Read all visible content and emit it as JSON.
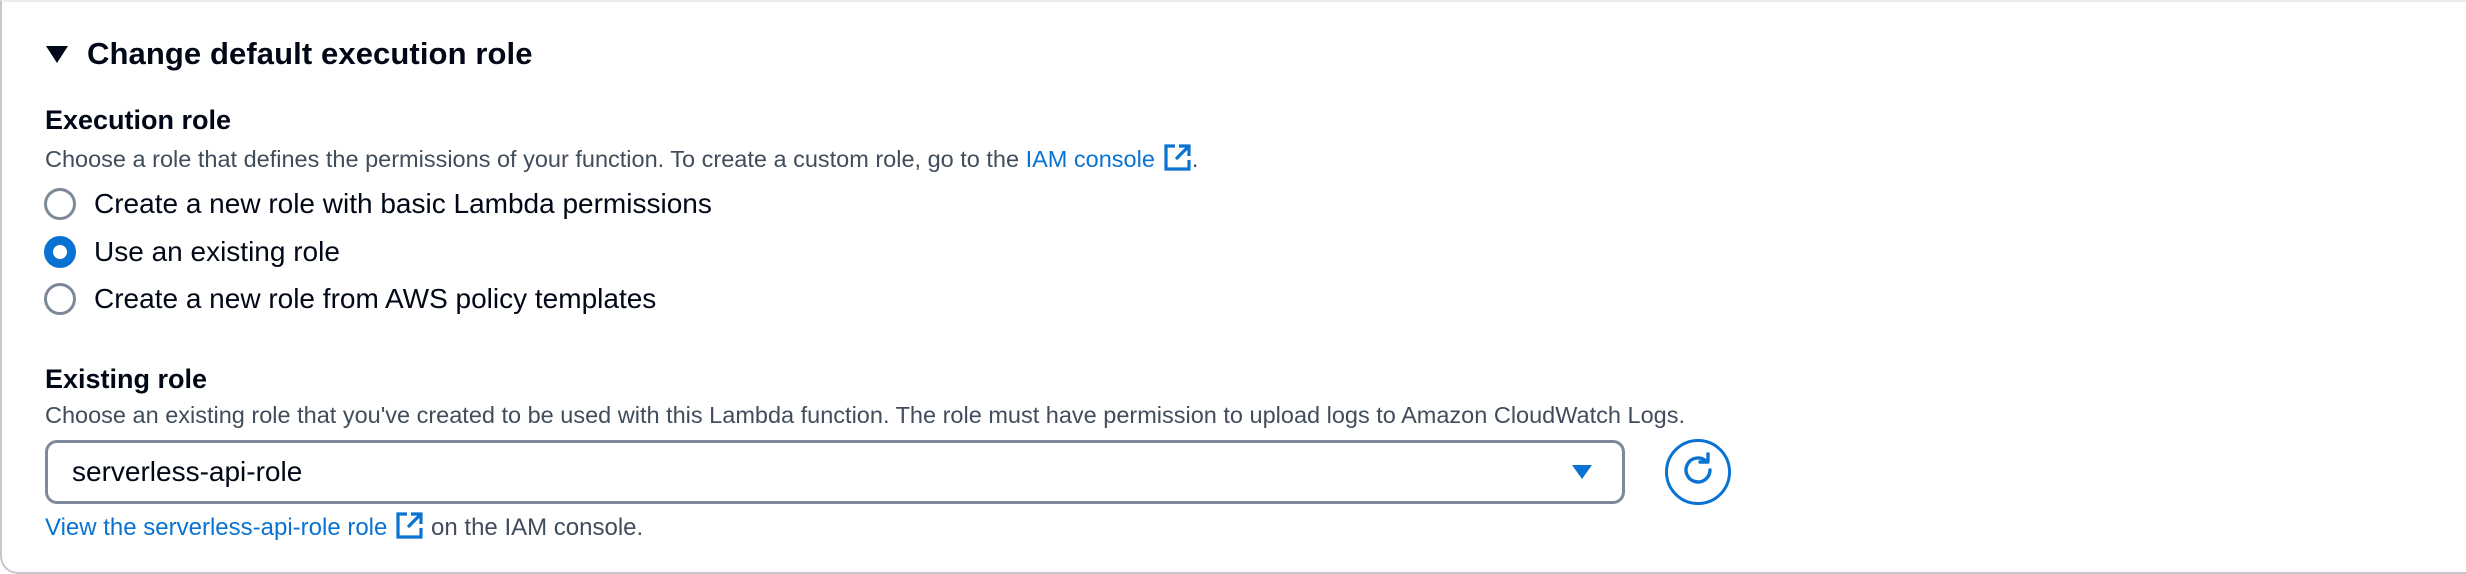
{
  "section": {
    "title": "Change default execution role",
    "execution_role": {
      "label": "Execution role",
      "description_prefix": "Choose a role that defines the permissions of your function. To create a custom role, go to the ",
      "description_link": "IAM console",
      "description_suffix": ".",
      "options": [
        {
          "label": "Create a new role with basic Lambda permissions",
          "selected": false
        },
        {
          "label": "Use an existing role",
          "selected": true
        },
        {
          "label": "Create a new role from AWS policy templates",
          "selected": false
        }
      ]
    },
    "existing_role": {
      "label": "Existing role",
      "description": "Choose an existing role that you've created to be used with this Lambda function. The role must have permission to upload logs to Amazon CloudWatch Logs.",
      "selected_value": "serverless-api-role",
      "hint_link": "View the serverless-api-role role",
      "hint_suffix": "on the IAM console."
    }
  },
  "colors": {
    "accent": "#0972d3",
    "text": "#000716",
    "secondary_text": "#414d5c",
    "border": "#7d8998"
  },
  "icons": {
    "expander": "caret-down-icon",
    "external_link": "external-link-icon",
    "dropdown": "dropdown-caret-icon",
    "refresh": "refresh-icon"
  }
}
